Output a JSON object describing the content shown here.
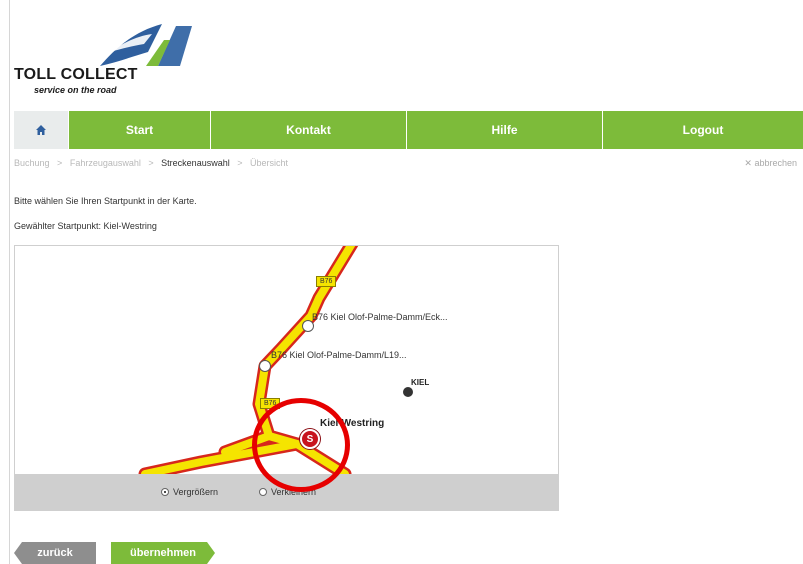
{
  "brand": {
    "name": "TOLL COLLECT",
    "tagline": "service on the road"
  },
  "nav": {
    "home_icon": "home-icon",
    "items": [
      {
        "label": "Start"
      },
      {
        "label": "Kontakt"
      },
      {
        "label": "Hilfe"
      },
      {
        "label": "Logout"
      }
    ]
  },
  "breadcrumb": {
    "steps": [
      {
        "label": "Buchung"
      },
      {
        "label": "Fahrzeugauswahl"
      },
      {
        "label": "Streckenauswahl"
      },
      {
        "label": "Übersicht"
      }
    ],
    "active_index": 2,
    "separator": ">"
  },
  "cancel": {
    "icon": "close-icon",
    "label": "abbrechen"
  },
  "instructions": "Bitte wählen Sie Ihren Startpunkt in der Karte.",
  "chosen_start": "Gewählter Startpunkt: Kiel-Westring",
  "map": {
    "road_shields": [
      "B76",
      "B76",
      "B76"
    ],
    "points": [
      {
        "label": "B76 Kiel Olof-Palme-Damm/Eck..."
      },
      {
        "label": "B76 Kiel Olof-Palme-Damm/L19..."
      }
    ],
    "city_label": "KIEL",
    "start_label": "Kiel-Westring",
    "start_marker": "S",
    "zoom_in_label": "Vergrößern",
    "zoom_out_label": "Verkleinern",
    "zoom_selected": "Vergrößern"
  },
  "buttons": {
    "back": "zurück",
    "next": "übernehmen"
  },
  "colors": {
    "brand_green": "#7dbb3a",
    "road_yellow": "#f5e400",
    "road_red": "#d7271c",
    "marker_red": "#c8141e",
    "highlight_ring": "#e60000",
    "logo_blue": "#2f5f9e"
  }
}
